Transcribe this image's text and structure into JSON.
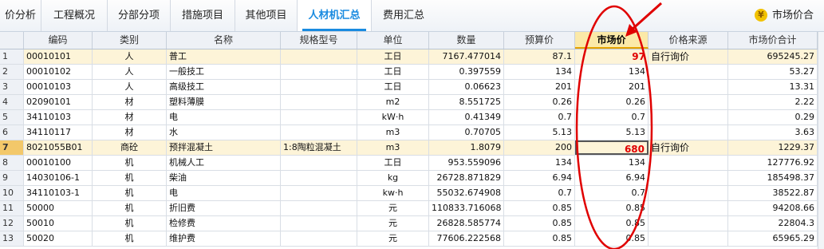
{
  "tabs": [
    "价分析",
    "工程概况",
    "分部分项",
    "措施项目",
    "其他项目",
    "人材机汇总",
    "费用汇总"
  ],
  "active_tab": "人材机汇总",
  "right_label": "市场价合计:",
  "columns": [
    "",
    "编码",
    "类别",
    "名称",
    "规格型号",
    "单位",
    "数量",
    "预算价",
    "市场价",
    "价格来源",
    "市场价合计"
  ],
  "rows": [
    {
      "idx": "1",
      "code": "00010101",
      "type": "人",
      "name": "普工",
      "spec": "",
      "unit": "工日",
      "qty": "7167.477014",
      "budget": "87.1",
      "market": "97",
      "source": "自行询价",
      "total": "695245.27"
    },
    {
      "idx": "2",
      "code": "00010102",
      "type": "人",
      "name": "一般技工",
      "spec": "",
      "unit": "工日",
      "qty": "0.397559",
      "budget": "134",
      "market": "134",
      "source": "",
      "total": "53.27"
    },
    {
      "idx": "3",
      "code": "00010103",
      "type": "人",
      "name": "高级技工",
      "spec": "",
      "unit": "工日",
      "qty": "0.06623",
      "budget": "201",
      "market": "201",
      "source": "",
      "total": "13.31"
    },
    {
      "idx": "4",
      "code": "02090101",
      "type": "材",
      "name": "塑料薄膜",
      "spec": "",
      "unit": "m2",
      "qty": "8.551725",
      "budget": "0.26",
      "market": "0.26",
      "source": "",
      "total": "2.22"
    },
    {
      "idx": "5",
      "code": "34110103",
      "type": "材",
      "name": "电",
      "spec": "",
      "unit": "kW·h",
      "qty": "0.41349",
      "budget": "0.7",
      "market": "0.7",
      "source": "",
      "total": "0.29"
    },
    {
      "idx": "6",
      "code": "34110117",
      "type": "材",
      "name": "水",
      "spec": "",
      "unit": "m3",
      "qty": "0.70705",
      "budget": "5.13",
      "market": "5.13",
      "source": "",
      "total": "3.63"
    },
    {
      "idx": "7",
      "code": "8021055B01",
      "type": "商砼",
      "name": "预拌混凝土",
      "spec": "1:8陶粒混凝土",
      "unit": "m3",
      "qty": "1.8079",
      "budget": "200",
      "market": "680",
      "source": "自行询价",
      "total": "1229.37"
    },
    {
      "idx": "8",
      "code": "00010100",
      "type": "机",
      "name": "机械人工",
      "spec": "",
      "unit": "工日",
      "qty": "953.559096",
      "budget": "134",
      "market": "134",
      "source": "",
      "total": "127776.92"
    },
    {
      "idx": "9",
      "code": "14030106-1",
      "type": "机",
      "name": "柴油",
      "spec": "",
      "unit": "kg",
      "qty": "26728.871829",
      "budget": "6.94",
      "market": "6.94",
      "source": "",
      "total": "185498.37"
    },
    {
      "idx": "10",
      "code": "34110103-1",
      "type": "机",
      "name": "电",
      "spec": "",
      "unit": "kw·h",
      "qty": "55032.674908",
      "budget": "0.7",
      "market": "0.7",
      "source": "",
      "total": "38522.87"
    },
    {
      "idx": "11",
      "code": "50000",
      "type": "机",
      "name": "折旧费",
      "spec": "",
      "unit": "元",
      "qty": "110833.716068",
      "budget": "0.85",
      "market": "0.85",
      "source": "",
      "total": "94208.66"
    },
    {
      "idx": "12",
      "code": "50010",
      "type": "机",
      "name": "检修费",
      "spec": "",
      "unit": "元",
      "qty": "26828.585774",
      "budget": "0.85",
      "market": "0.85",
      "source": "",
      "total": "22804.3"
    },
    {
      "idx": "13",
      "code": "50020",
      "type": "机",
      "name": "维护费",
      "spec": "",
      "unit": "元",
      "qty": "77606.222568",
      "budget": "0.85",
      "market": "0.85",
      "source": "",
      "total": "65965.29"
    }
  ],
  "colors": {
    "active_tab": "#1a8be0",
    "highlight_row": "#fdf4d8",
    "annotation": "#e00000"
  }
}
